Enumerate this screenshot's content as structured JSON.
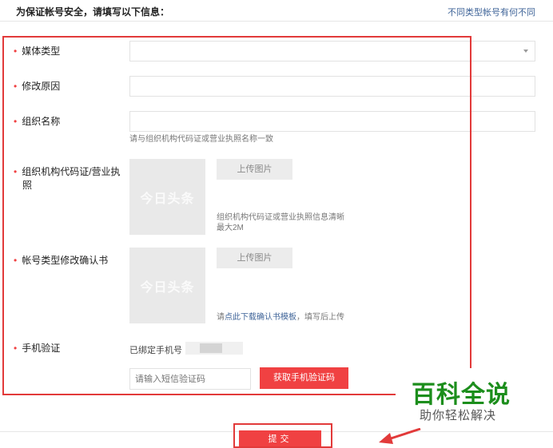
{
  "header": {
    "title": "为保证帐号安全，请填写以下信息：",
    "link": "不同类型帐号有何不同"
  },
  "form": {
    "media_type": {
      "label": "媒体类型",
      "value": ""
    },
    "reason": {
      "label": "修改原因",
      "value": ""
    },
    "org_name": {
      "label": "组织名称",
      "value": "",
      "hint": "请与组织机构代码证或营业执照名称一致"
    },
    "org_code": {
      "label_line1": "组织机构代码证/营业执",
      "label_line2": "照",
      "thumb_text": "今日头条",
      "upload_label": "上传图片",
      "hint_line1": "组织机构代码证或营业执照信息清晰",
      "hint_line2": "最大2M"
    },
    "confirm_letter": {
      "label": "帐号类型修改确认书",
      "thumb_text": "今日头条",
      "upload_label": "上传图片",
      "hint_prefix": "请",
      "hint_link": "点此下载确认书模板",
      "hint_suffix": "，填写后上传"
    },
    "phone": {
      "label": "手机验证",
      "bound_label": "已绑定手机号",
      "sms_placeholder": "请输入短信验证码",
      "get_code_label": "获取手机验证码"
    },
    "submit_label": "提交"
  },
  "watermark": {
    "title": "百科全说",
    "subtitle": "助你轻松解决"
  },
  "colors": {
    "accent_red": "#f04142",
    "link_blue": "#406599",
    "annotation_red": "#e23a3a",
    "watermark_green": "#1c8e1c"
  }
}
